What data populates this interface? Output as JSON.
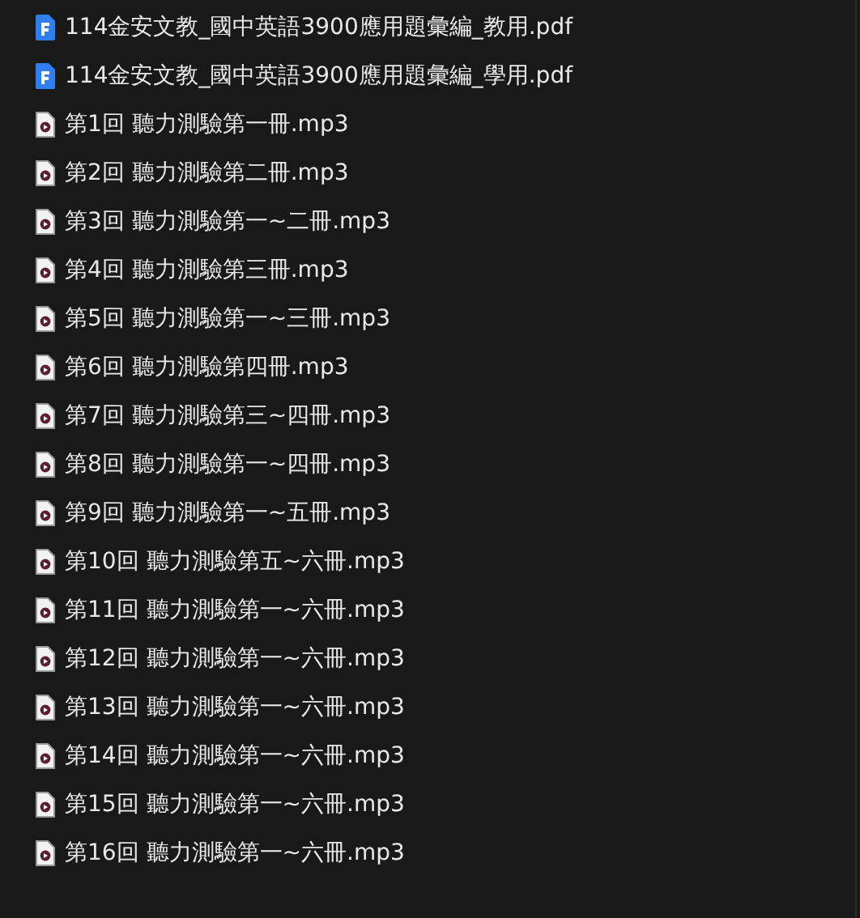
{
  "files": [
    {
      "name": "114金安文教_國中英語3900應用題彙編_教用.pdf",
      "kind": "pdf"
    },
    {
      "name": "114金安文教_國中英語3900應用題彙編_學用.pdf",
      "kind": "pdf"
    },
    {
      "name": "第1回 聽力測驗第一冊.mp3",
      "kind": "audio"
    },
    {
      "name": "第2回 聽力測驗第二冊.mp3",
      "kind": "audio"
    },
    {
      "name": "第3回 聽力測驗第一~二冊.mp3",
      "kind": "audio"
    },
    {
      "name": "第4回 聽力測驗第三冊.mp3",
      "kind": "audio"
    },
    {
      "name": "第5回 聽力測驗第一~三冊.mp3",
      "kind": "audio"
    },
    {
      "name": "第6回 聽力測驗第四冊.mp3",
      "kind": "audio"
    },
    {
      "name": "第7回 聽力測驗第三~四冊.mp3",
      "kind": "audio"
    },
    {
      "name": "第8回 聽力測驗第一~四冊.mp3",
      "kind": "audio"
    },
    {
      "name": "第9回 聽力測驗第一~五冊.mp3",
      "kind": "audio"
    },
    {
      "name": "第10回 聽力測驗第五~六冊.mp3",
      "kind": "audio"
    },
    {
      "name": "第11回 聽力測驗第一~六冊.mp3",
      "kind": "audio"
    },
    {
      "name": "第12回 聽力測驗第一~六冊.mp3",
      "kind": "audio"
    },
    {
      "name": "第13回 聽力測驗第一~六冊.mp3",
      "kind": "audio"
    },
    {
      "name": "第14回 聽力測驗第一~六冊.mp3",
      "kind": "audio"
    },
    {
      "name": "第15回 聽力測驗第一~六冊.mp3",
      "kind": "audio"
    },
    {
      "name": "第16回 聽力測驗第一~六冊.mp3",
      "kind": "audio"
    }
  ]
}
